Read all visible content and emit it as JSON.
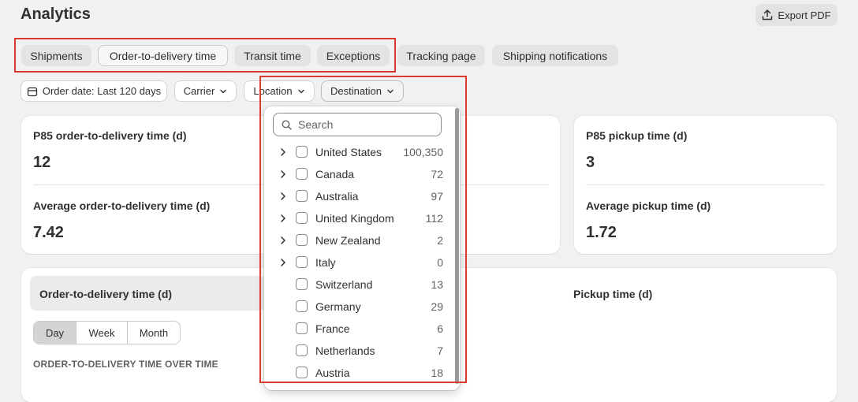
{
  "header": {
    "title": "Analytics",
    "export_label": "Export PDF"
  },
  "tabs": [
    {
      "label": "Shipments",
      "active": false
    },
    {
      "label": "Order-to-delivery time",
      "active": true
    },
    {
      "label": "Transit time",
      "active": false
    },
    {
      "label": "Exceptions",
      "active": false
    },
    {
      "label": "Tracking page",
      "active": false
    },
    {
      "label": "Shipping notifications",
      "active": false
    }
  ],
  "filters": {
    "date": "Order date: Last 120 days",
    "carrier": "Carrier",
    "location": "Location",
    "destination": "Destination"
  },
  "metrics_left": {
    "p85_label": "P85 order-to-delivery time (d)",
    "p85_value": "12",
    "avg_label": "Average order-to-delivery time (d)",
    "avg_value": "7.42"
  },
  "metrics_right": {
    "p85_label": "P85 pickup time (d)",
    "p85_value": "3",
    "avg_label": "Average pickup time (d)",
    "avg_value": "1.72"
  },
  "chart": {
    "header": "Order-to-delivery time (d)",
    "segments": [
      "Day",
      "Week",
      "Month"
    ],
    "selected_segment": "Day",
    "subtitle": "ORDER-TO-DELIVERY TIME OVER TIME",
    "pickup_title": "Pickup time (d)"
  },
  "destination_popover": {
    "search_placeholder": "Search",
    "options": [
      {
        "name": "United States",
        "count": "100,350",
        "expandable": true
      },
      {
        "name": "Canada",
        "count": "72",
        "expandable": true
      },
      {
        "name": "Australia",
        "count": "97",
        "expandable": true
      },
      {
        "name": "United Kingdom",
        "count": "112",
        "expandable": true
      },
      {
        "name": "New Zealand",
        "count": "2",
        "expandable": true
      },
      {
        "name": "Italy",
        "count": "0",
        "expandable": true
      },
      {
        "name": "Switzerland",
        "count": "13",
        "expandable": false
      },
      {
        "name": "Germany",
        "count": "29",
        "expandable": false
      },
      {
        "name": "France",
        "count": "6",
        "expandable": false
      },
      {
        "name": "Netherlands",
        "count": "7",
        "expandable": false
      },
      {
        "name": "Austria",
        "count": "18",
        "expandable": false
      }
    ]
  },
  "colors": {
    "highlight": "#dd3b2f",
    "background": "#f1f1f1"
  }
}
